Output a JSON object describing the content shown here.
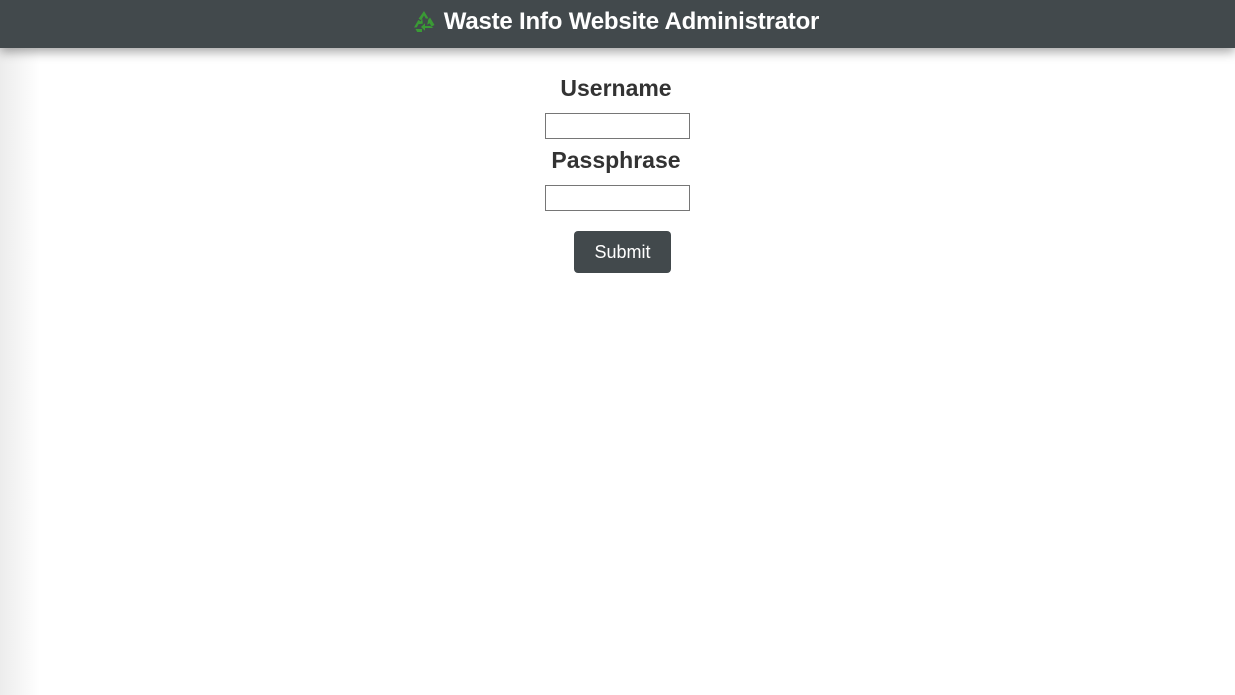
{
  "header": {
    "icon": "recycle-icon",
    "title": "Waste Info Website Administrator",
    "background": "#42494c"
  },
  "login_form": {
    "username_label": "Username",
    "username_value": "",
    "passphrase_label": "Passphrase",
    "passphrase_value": "",
    "submit_label": "Submit"
  },
  "colors": {
    "icon_green": "#3a9a35",
    "label_text": "#333333",
    "button_background": "#42494c"
  }
}
